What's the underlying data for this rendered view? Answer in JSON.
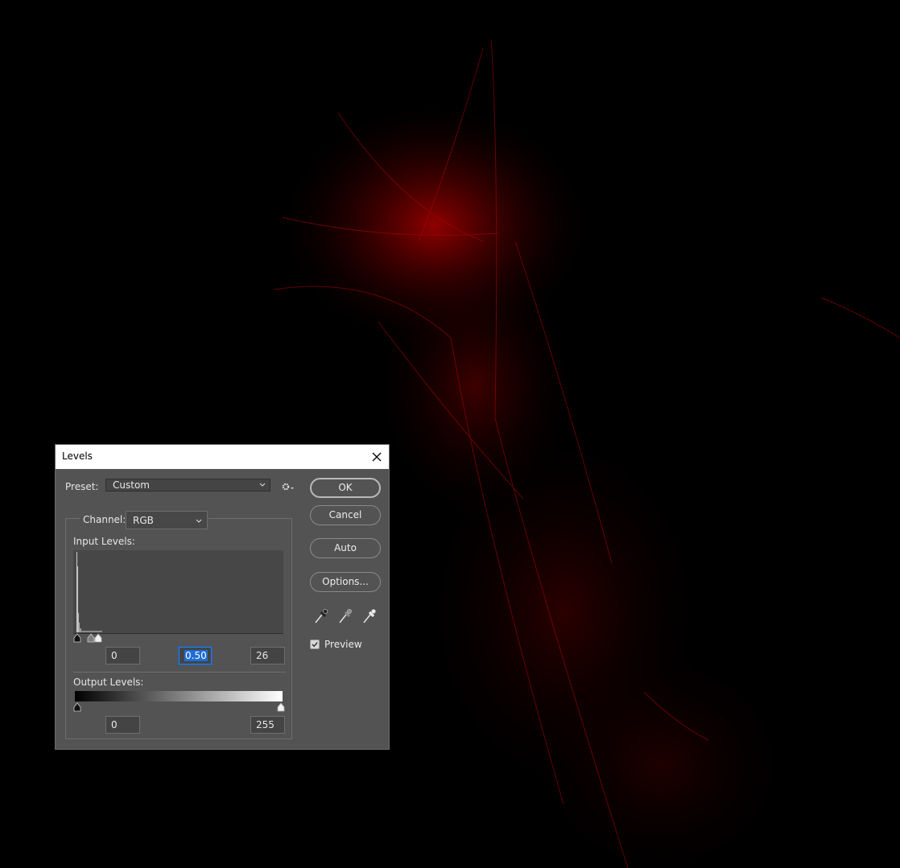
{
  "dialog": {
    "title": "Levels",
    "preset": {
      "label": "Preset:",
      "value": "Custom"
    },
    "channel": {
      "label": "Channel:",
      "value": "RGB"
    },
    "input_levels": {
      "label": "Input Levels:",
      "black": "0",
      "gamma": "0.50",
      "white": "26"
    },
    "output_levels": {
      "label": "Output Levels:",
      "black": "0",
      "white": "255"
    },
    "buttons": {
      "ok": "OK",
      "cancel": "Cancel",
      "auto": "Auto",
      "options": "Options..."
    },
    "preview": {
      "label": "Preview",
      "checked": true
    }
  },
  "icons": {
    "close": "close-icon",
    "settings": "gear-icon",
    "eyedroppers": [
      "black-point-eyedropper-icon",
      "gray-point-eyedropper-icon",
      "white-point-eyedropper-icon"
    ]
  },
  "colors": {
    "dialog_bg": "#535353",
    "canvas_accent": "#c00000",
    "selection": "#1f6ed4"
  }
}
